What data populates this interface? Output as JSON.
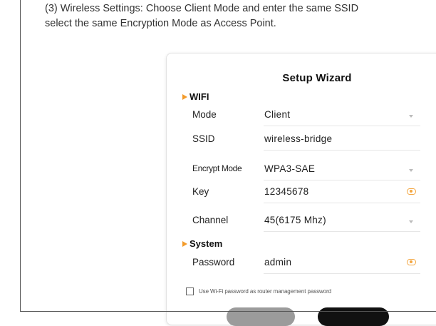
{
  "instruction": {
    "line1": "(3) Wireless Settings: Choose Client Mode and enter the same SSID",
    "line2": "select the same Encryption Mode as Access Point."
  },
  "wizard": {
    "title": "Setup Wizard",
    "wifi_section": "WIFI",
    "mode": {
      "label": "Mode",
      "value": "Client"
    },
    "ssid": {
      "label": "SSID",
      "value": "wireless-bridge"
    },
    "encrypt_mode": {
      "label": "Encrypt Mode",
      "value": "WPA3-SAE"
    },
    "key": {
      "label": "Key",
      "value": "12345678"
    },
    "channel": {
      "label": "Channel",
      "value": "45(6175 Mhz)"
    },
    "system_section": "System",
    "password": {
      "label": "Password",
      "value": "admin"
    },
    "checkbox_label": "Use Wi-Fi password as router management password"
  },
  "colors": {
    "accent": "#f39b2b",
    "back_button": "#9b9b9b",
    "next_button": "#111111"
  }
}
